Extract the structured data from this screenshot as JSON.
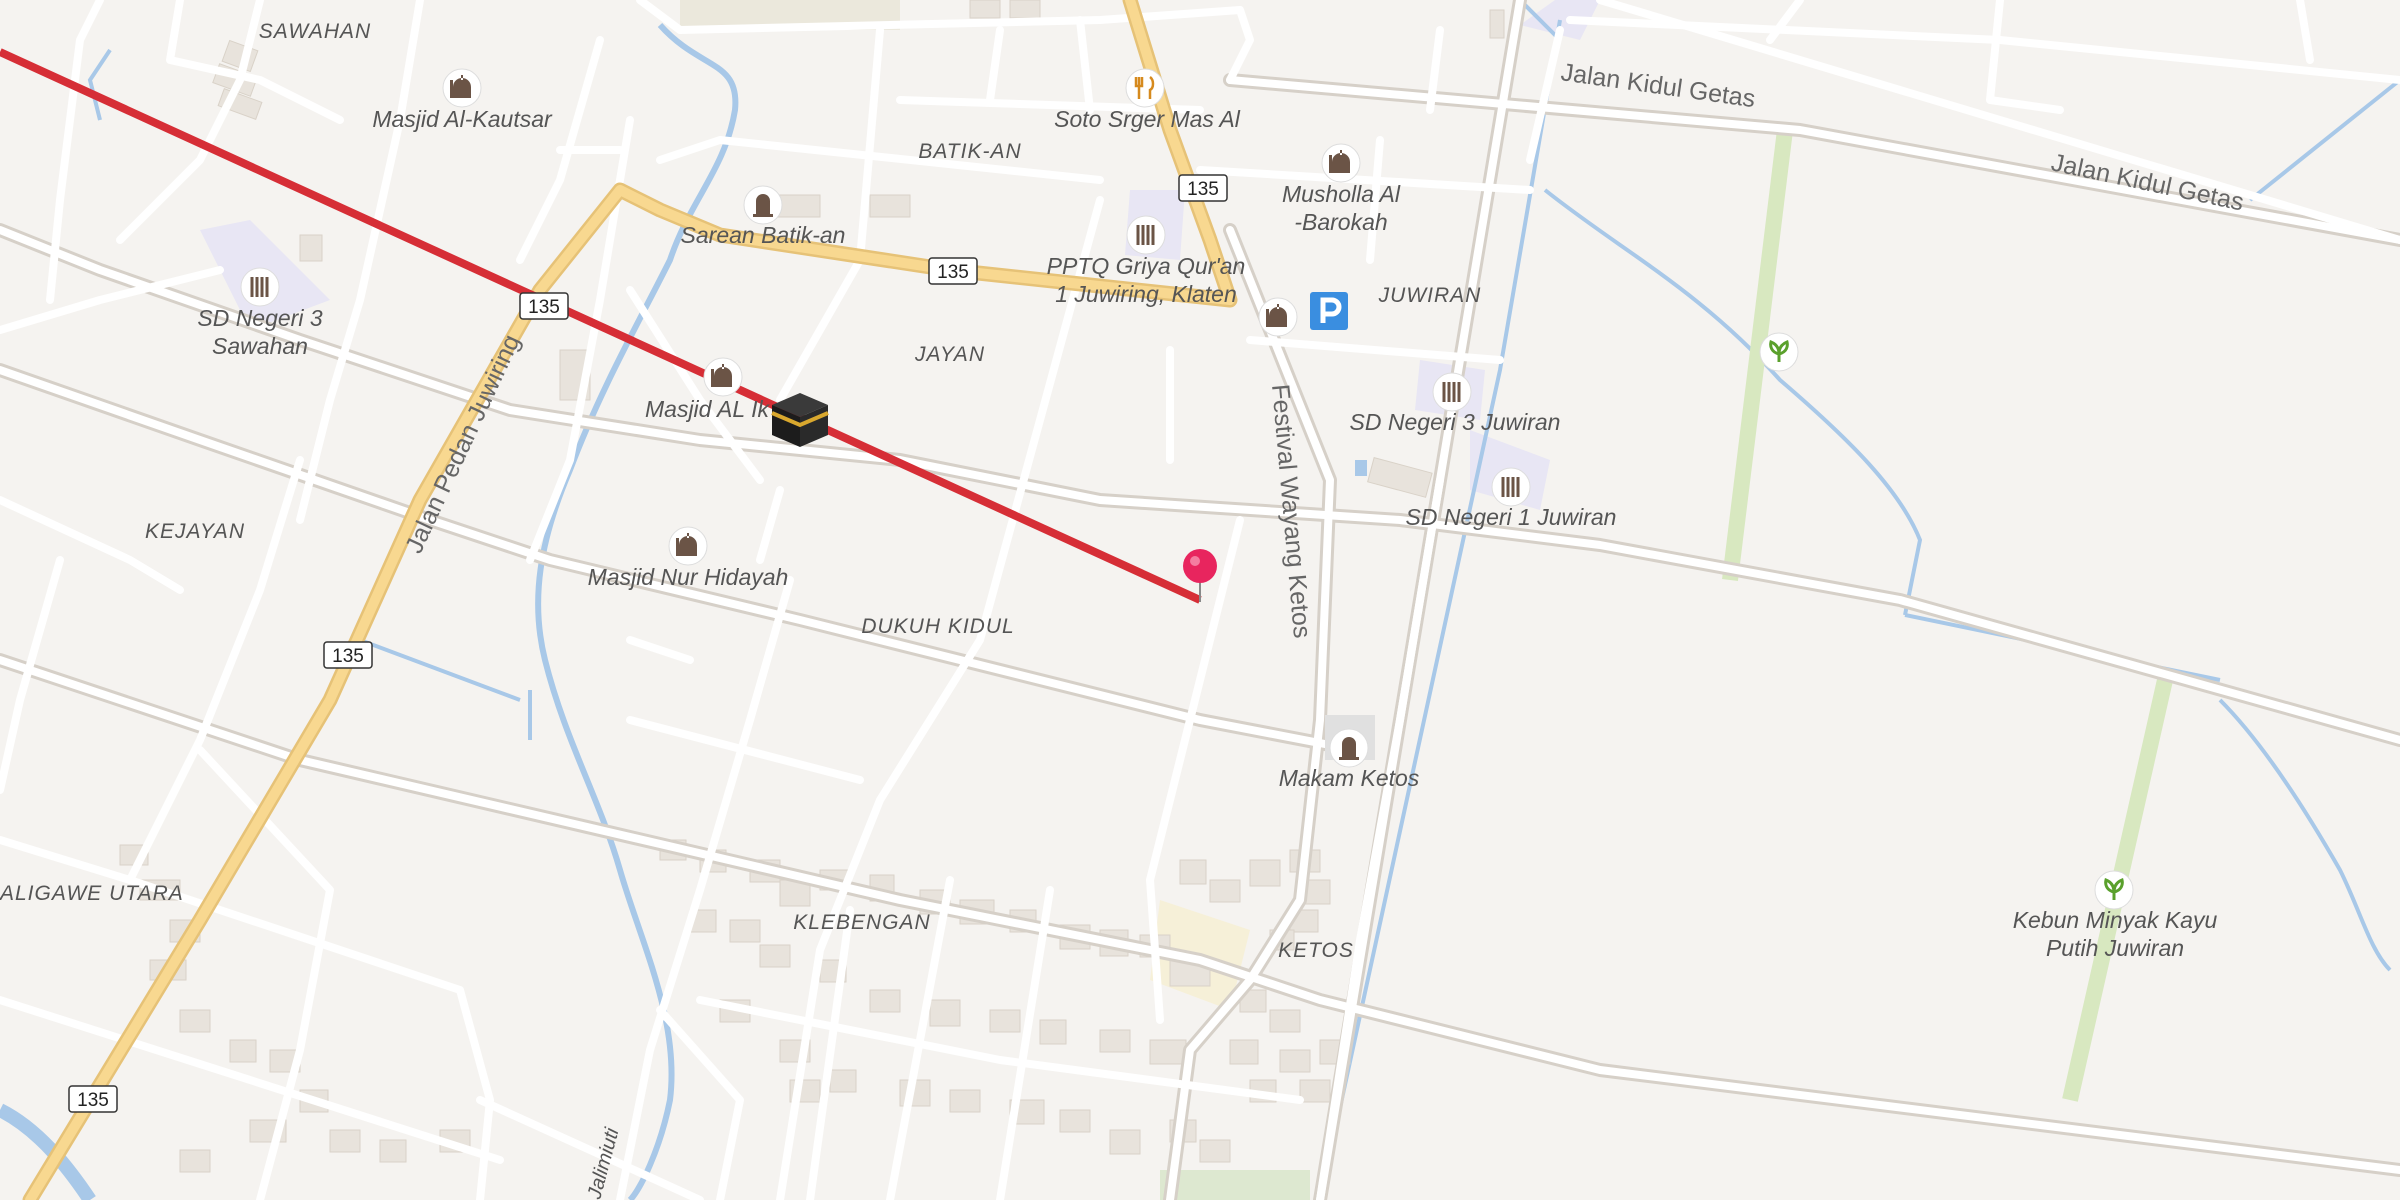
{
  "map": {
    "place_labels": {
      "sawahan": "SAWAHAN",
      "batik_an": "BATIK-AN",
      "jayan": "JAYAN",
      "juwiran": "JUWIRAN",
      "kejayan": "KEJAYAN",
      "dukuh_kidul": "DUKUH KIDUL",
      "klebengan": "KLEBENGAN",
      "ketos": "KETOS",
      "aligawe_utara": "ALIGAWE UTARA"
    },
    "poi_labels": {
      "masjid_al_kautsar": "Masjid Al-Kautsar",
      "soto_srger": "Soto Srger Mas Al",
      "sarean_batik_an": "Sarean Batik-an",
      "musholla_1": "Musholla Al",
      "musholla_2": "-Barokah",
      "pptq_1": "PPTQ Griya Qur'an",
      "pptq_2": "1 Juwiring, Klaten",
      "sd_sawahan_1": "SD Negeri 3",
      "sd_sawahan_2": "Sawahan",
      "masjid_al_ikhlas": "Masjid AL Ik",
      "sd_juwiran_3": "SD Negeri 3 Juwiran",
      "sd_juwiran_1": "SD Negeri 1 Juwiran",
      "masjid_nur_hidayah": "Masjid Nur Hidayah",
      "makam_ketos": "Makam Ketos",
      "kebun_1": "Kebun Minyak Kayu",
      "kebun_2": "Putih Juwiran"
    },
    "road_labels": {
      "jalan_kidul_getas_1": "Jalan Kidul Getas",
      "jalan_kidul_getas_2": "Jalan Kidul Getas",
      "jalan_pedan_juwiring": "Jalan Pedan Juwiring",
      "festival_wayang_ketos": "Festival Wayang Ketos",
      "river": "Jalimiuti"
    },
    "route_shields": [
      "135",
      "135",
      "135",
      "135",
      "135"
    ],
    "colors": {
      "background": "#f5f3f0",
      "road": "#ffffff",
      "highway": "#f8d890",
      "water": "#a8c8e8",
      "qibla_line": "#d62e36",
      "pin": "#e8255e",
      "park_strip": "#d8e8c0",
      "parking": "#3a8ee0"
    },
    "icons": [
      "kaaba-icon",
      "location-pin-icon",
      "mosque-icon",
      "restaurant-icon",
      "grave-icon",
      "school-icon",
      "parking-icon",
      "garden-icon"
    ]
  }
}
